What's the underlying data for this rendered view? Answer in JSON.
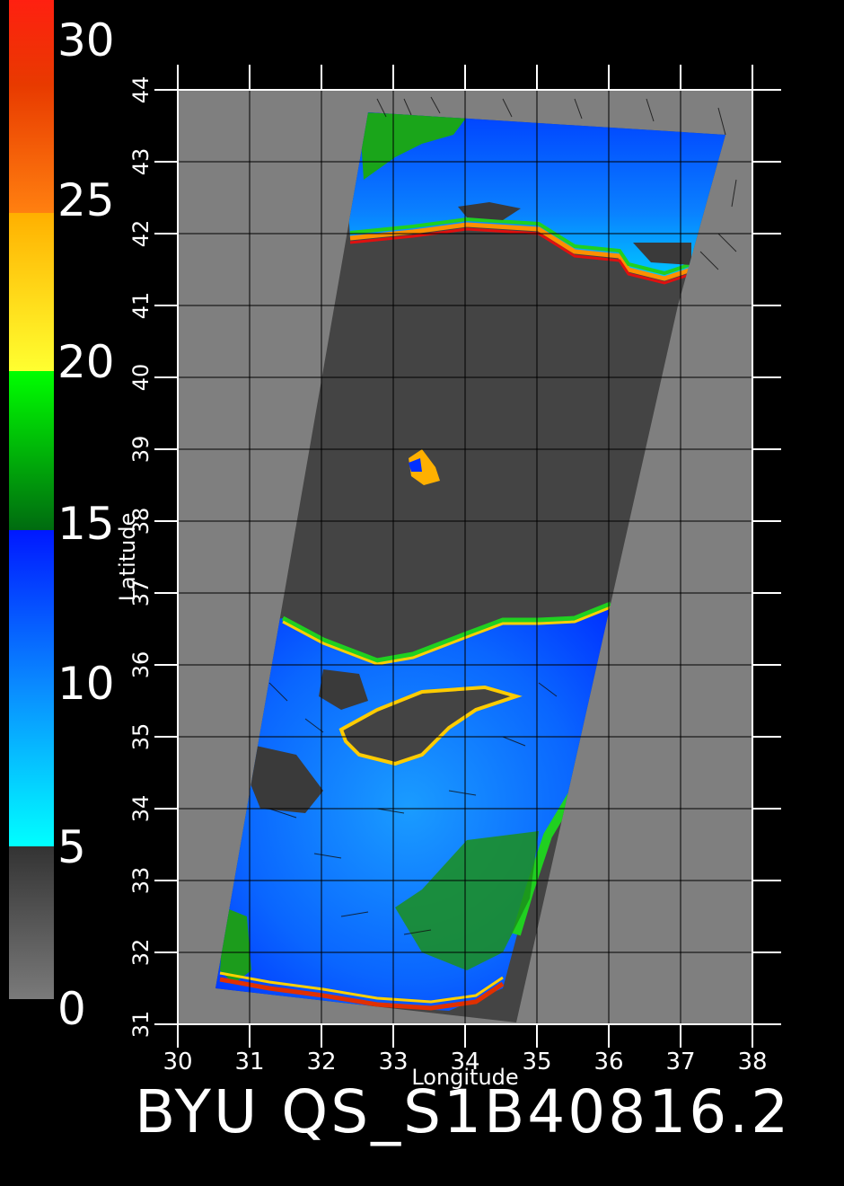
{
  "colorbar": {
    "labels": [
      "30",
      "25",
      "20",
      "15",
      "10",
      "5",
      "0"
    ],
    "colors": {
      "gray_low": "#7a7a7a",
      "gray_high": "#3a3a3a",
      "cyan": "#00ffff",
      "blue": "#0018ff",
      "green_light": "#00ff00",
      "green_dark": "#006b10",
      "yellow": "#ffff30",
      "orange": "#ffb000",
      "red": "#ff2010"
    }
  },
  "map": {
    "x_axis_label": "Longitude",
    "y_axis_label": "Latitude",
    "lon_ticks": [
      "30",
      "31",
      "32",
      "33",
      "34",
      "35",
      "36",
      "37",
      "38"
    ],
    "lat_ticks": [
      "31",
      "32",
      "33",
      "34",
      "35",
      "36",
      "37",
      "38",
      "39",
      "40",
      "41",
      "42",
      "43",
      "44"
    ],
    "lon_range": [
      30,
      38
    ],
    "lat_range": [
      31,
      44
    ],
    "colors": {
      "background": "#7f7f7f",
      "land": "#444444",
      "grid": "#000000",
      "frame": "#ffffff"
    }
  },
  "footer": {
    "title": "BYU QS_S1B40816.2"
  }
}
